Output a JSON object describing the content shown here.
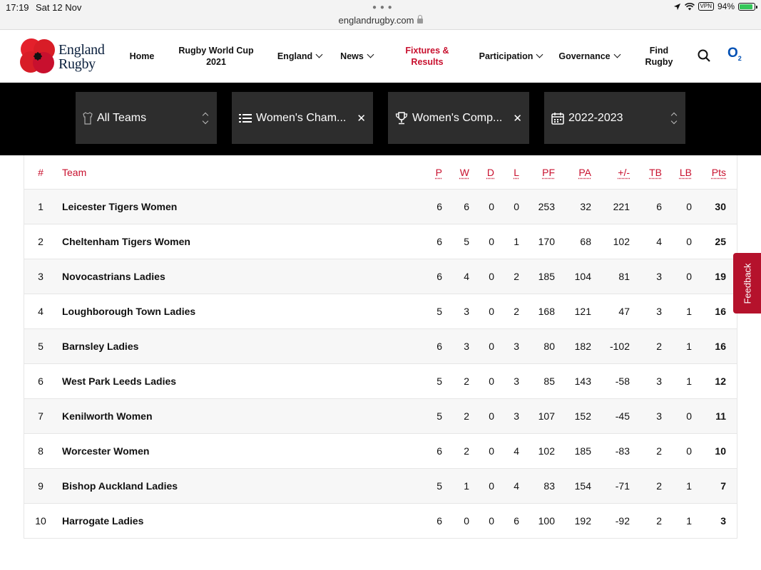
{
  "status_bar": {
    "time": "17:19",
    "date": "Sat 12 Nov",
    "url": "englandrugby.com",
    "vpn": "VPN",
    "battery": "94%",
    "battery_level": 0.94
  },
  "header": {
    "logo_line1": "England",
    "logo_line2": "Rugby",
    "nav": [
      {
        "label": "Home",
        "dropdown": false,
        "active": false
      },
      {
        "label": "Rugby World Cup 2021",
        "dropdown": false,
        "active": false
      },
      {
        "label": "England",
        "dropdown": true,
        "active": false
      },
      {
        "label": "News",
        "dropdown": true,
        "active": false
      },
      {
        "label": "Fixtures & Results",
        "dropdown": false,
        "active": true
      },
      {
        "label": "Participation",
        "dropdown": true,
        "active": false
      },
      {
        "label": "Governance",
        "dropdown": true,
        "active": false
      },
      {
        "label": "Find Rugby",
        "dropdown": false,
        "active": false
      }
    ],
    "sponsor": "O",
    "sponsor_sub": "2",
    "icons": [
      "search-icon",
      "o2-logo"
    ]
  },
  "filters": [
    {
      "label": "All Teams",
      "icon": "shirt-icon",
      "control": "updown"
    },
    {
      "label": "Women's Cham...",
      "icon": "list-icon",
      "control": "clear"
    },
    {
      "label": "Women's Comp...",
      "icon": "trophy-icon",
      "control": "clear"
    },
    {
      "label": "2022-2023",
      "icon": "calendar-icon",
      "control": "updown"
    }
  ],
  "filter_clear_glyph": "✕",
  "table": {
    "columns": [
      "#",
      "Team",
      "P",
      "W",
      "D",
      "L",
      "PF",
      "PA",
      "+/-",
      "TB",
      "LB",
      "Pts"
    ],
    "rows": [
      [
        "1",
        "Leicester Tigers Women",
        "6",
        "6",
        "0",
        "0",
        "253",
        "32",
        "221",
        "6",
        "0",
        "30"
      ],
      [
        "2",
        "Cheltenham Tigers Women",
        "6",
        "5",
        "0",
        "1",
        "170",
        "68",
        "102",
        "4",
        "0",
        "25"
      ],
      [
        "3",
        "Novocastrians Ladies",
        "6",
        "4",
        "0",
        "2",
        "185",
        "104",
        "81",
        "3",
        "0",
        "19"
      ],
      [
        "4",
        "Loughborough Town Ladies",
        "5",
        "3",
        "0",
        "2",
        "168",
        "121",
        "47",
        "3",
        "1",
        "16"
      ],
      [
        "5",
        "Barnsley Ladies",
        "6",
        "3",
        "0",
        "3",
        "80",
        "182",
        "-102",
        "2",
        "1",
        "16"
      ],
      [
        "6",
        "West Park Leeds Ladies",
        "5",
        "2",
        "0",
        "3",
        "85",
        "143",
        "-58",
        "3",
        "1",
        "12"
      ],
      [
        "7",
        "Kenilworth Women",
        "5",
        "2",
        "0",
        "3",
        "107",
        "152",
        "-45",
        "3",
        "0",
        "11"
      ],
      [
        "8",
        "Worcester Women",
        "6",
        "2",
        "0",
        "4",
        "102",
        "185",
        "-83",
        "2",
        "0",
        "10"
      ],
      [
        "9",
        "Bishop Auckland Ladies",
        "5",
        "1",
        "0",
        "4",
        "83",
        "154",
        "-71",
        "2",
        "1",
        "7"
      ],
      [
        "10",
        "Harrogate Ladies",
        "6",
        "0",
        "0",
        "6",
        "100",
        "192",
        "-92",
        "2",
        "1",
        "3"
      ]
    ]
  },
  "feedback_label": "Feedback",
  "colors": {
    "accent": "#c8102e",
    "filter_bar": "#000000",
    "filter_box": "#2d2d2d",
    "feedback": "#b5122c",
    "sponsor": "#0050b4"
  }
}
